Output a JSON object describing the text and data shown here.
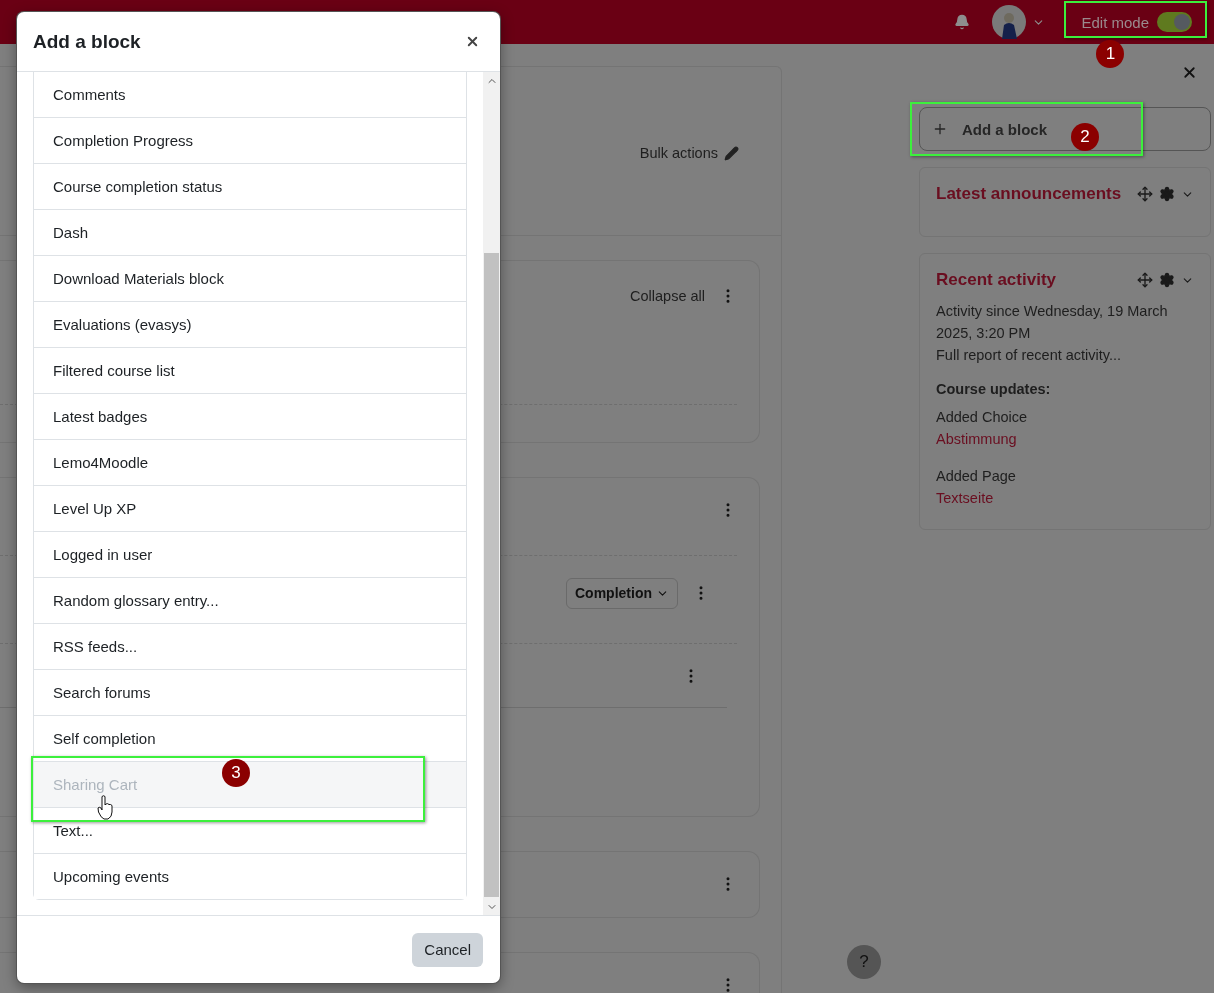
{
  "header": {
    "edit_mode": {
      "label": "Edit mode",
      "on": true,
      "callout": "1"
    }
  },
  "course": {
    "bulk_actions": "Bulk actions",
    "collapse_all": "Collapse all",
    "completion_button": "Completion"
  },
  "drawer": {
    "add_block": {
      "label": "Add a block",
      "callout": "2"
    },
    "blocks": [
      {
        "kind": "announcements",
        "title": "Latest announcements"
      },
      {
        "kind": "recent",
        "title": "Recent activity",
        "since": "Activity since Wednesday, 19 March 2025, 3:20 PM",
        "report": "Full report of recent activity...",
        "updates_title": "Course updates:",
        "updates": [
          {
            "action": "Added Choice",
            "link": "Abstimmung"
          },
          {
            "action": "Added Page",
            "link": "Textseite"
          }
        ]
      }
    ]
  },
  "help": "?",
  "modal": {
    "title": "Add a block",
    "cancel": "Cancel",
    "items": [
      {
        "label": "Comments",
        "highlighted": false
      },
      {
        "label": "Completion Progress",
        "highlighted": false
      },
      {
        "label": "Course completion status",
        "highlighted": false
      },
      {
        "label": "Dash",
        "highlighted": false
      },
      {
        "label": "Download Materials block",
        "highlighted": false
      },
      {
        "label": "Evaluations (evasys)",
        "highlighted": false
      },
      {
        "label": "Filtered course list",
        "highlighted": false
      },
      {
        "label": "Latest badges",
        "highlighted": false
      },
      {
        "label": "Lemo4Moodle",
        "highlighted": false
      },
      {
        "label": "Level Up XP",
        "highlighted": false
      },
      {
        "label": "Logged in user",
        "highlighted": false
      },
      {
        "label": "Random glossary entry...",
        "highlighted": false
      },
      {
        "label": "RSS feeds...",
        "highlighted": false
      },
      {
        "label": "Search forums",
        "highlighted": false
      },
      {
        "label": "Self completion",
        "highlighted": false
      },
      {
        "label": "Sharing Cart",
        "highlighted": true,
        "callout": "3"
      },
      {
        "label": "Text...",
        "highlighted": false
      },
      {
        "label": "Upcoming events",
        "highlighted": false
      }
    ]
  }
}
